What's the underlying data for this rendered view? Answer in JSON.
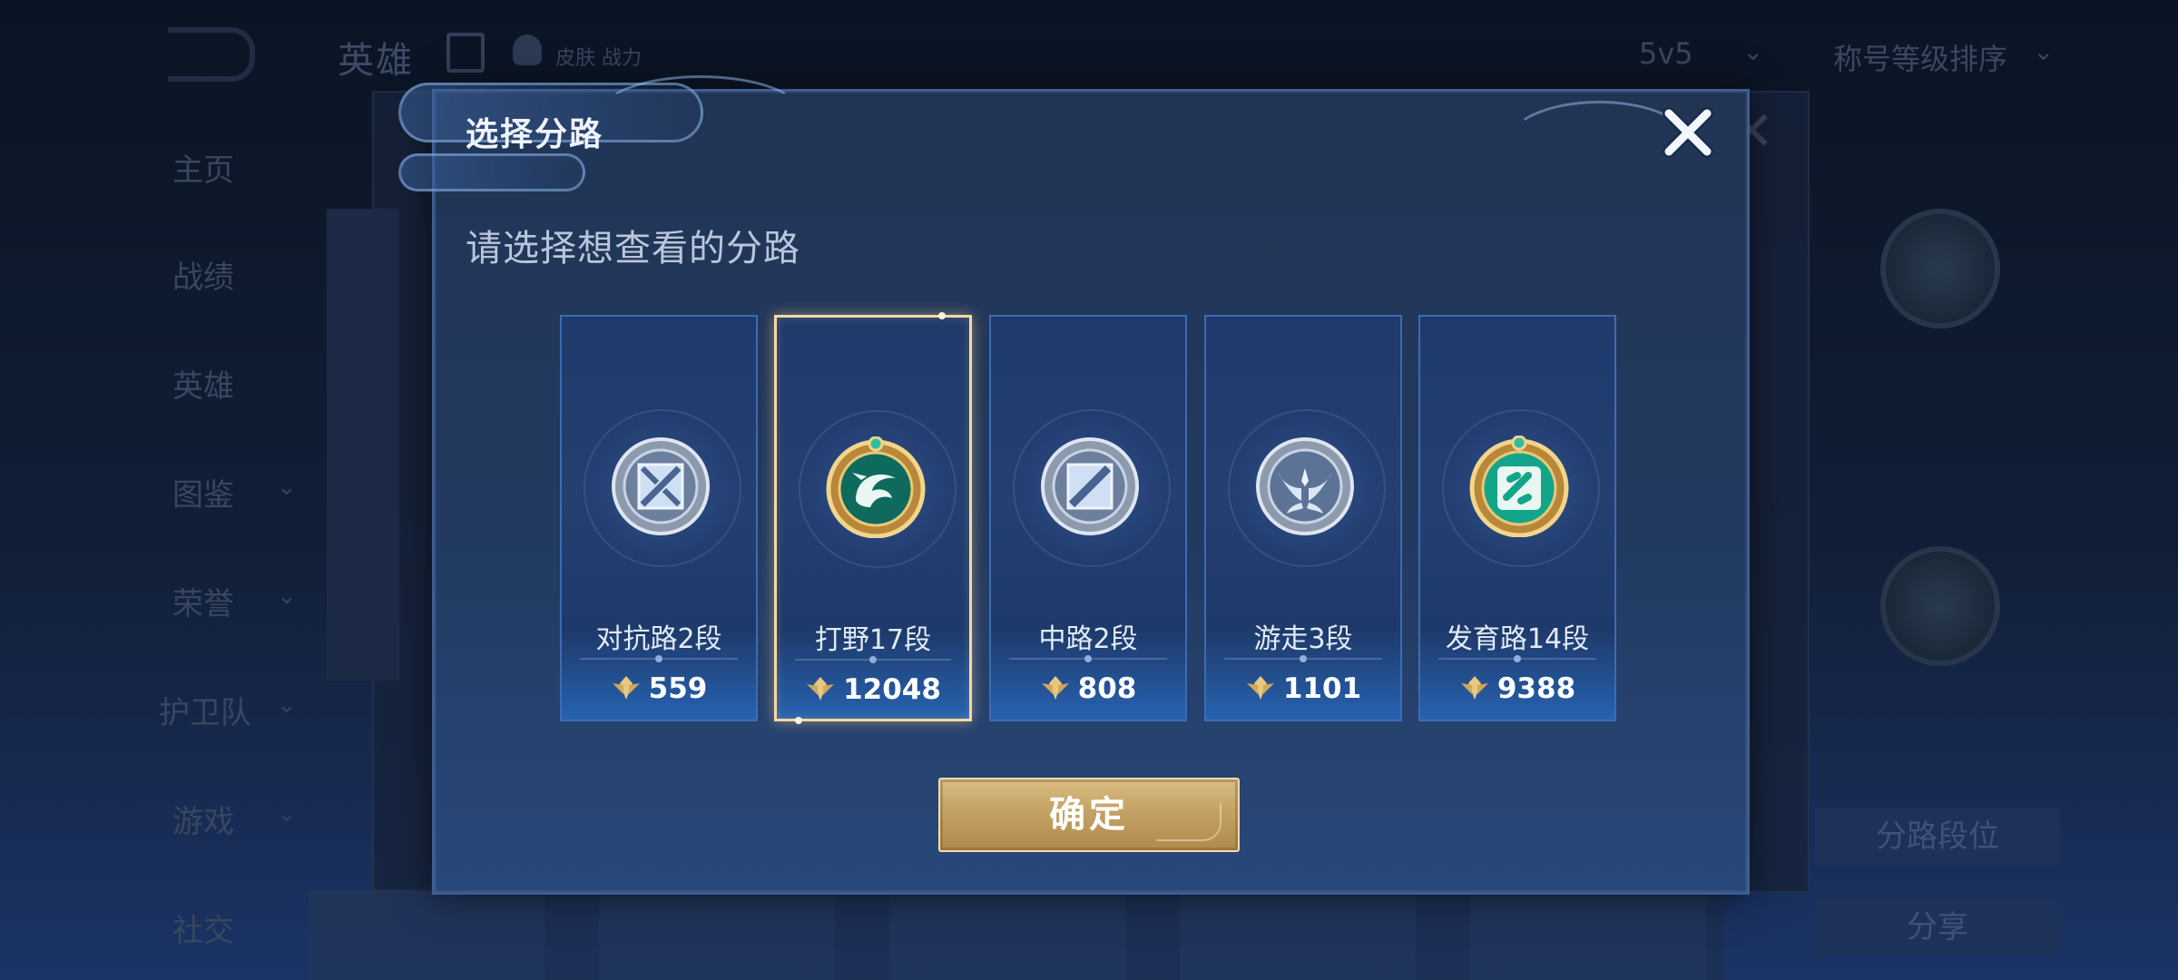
{
  "background": {
    "title": "英雄",
    "subtitle": "皮肤 战力",
    "mode": "5v5",
    "sort": "称号等级排序",
    "sidebar": [
      "主页",
      "战绩",
      "英雄",
      "图鉴",
      "荣誉",
      "护卫队",
      "游戏",
      "社交"
    ],
    "right_button": "分路段位",
    "share_button": "分享"
  },
  "modal": {
    "title": "选择分路",
    "subtitle": "请选择想查看的分路",
    "confirm_label": "确定",
    "close_icon": "close-icon",
    "selected_index": 1,
    "lanes": [
      {
        "label": "对抗路2段",
        "points": "559",
        "icon": "clash-lane-emblem",
        "tier": "silver"
      },
      {
        "label": "打野17段",
        "points": "12048",
        "icon": "jungle-dragon-emblem",
        "tier": "gold"
      },
      {
        "label": "中路2段",
        "points": "808",
        "icon": "mid-lane-emblem",
        "tier": "silver"
      },
      {
        "label": "游走3段",
        "points": "1101",
        "icon": "roam-wings-emblem",
        "tier": "silver"
      },
      {
        "label": "发育路14段",
        "points": "9388",
        "icon": "farm-lane-emblem",
        "tier": "gold"
      }
    ]
  },
  "colors": {
    "selected_border": "#f6d9a0",
    "gold_button": "#c4a265",
    "card_blue": "#243f70"
  }
}
